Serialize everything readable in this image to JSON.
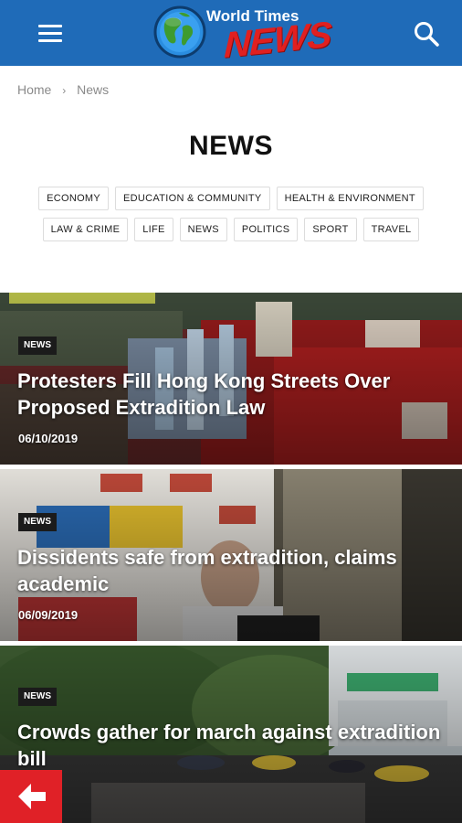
{
  "header": {
    "logo_top": "World Times",
    "logo_bottom": "NEWS",
    "menu_icon": "hamburger-menu-icon",
    "search_icon": "search-icon",
    "bar_color": "#1f6bb8"
  },
  "breadcrumb": {
    "home": "Home",
    "separator": "›",
    "current": "News"
  },
  "page_title": "NEWS",
  "categories": [
    "ECONOMY",
    "EDUCATION & COMMUNITY",
    "HEALTH & ENVIRONMENT",
    "LAW & CRIME",
    "LIFE",
    "NEWS",
    "POLITICS",
    "SPORT",
    "TRAVEL"
  ],
  "articles": [
    {
      "tag": "NEWS",
      "title": "Protesters Fill Hong Kong Streets Over Proposed Extradition Law",
      "date": "06/10/2019"
    },
    {
      "tag": "NEWS",
      "title": "Dissidents safe from extradition, claims academic",
      "date": "06/09/2019"
    },
    {
      "tag": "NEWS",
      "title": "Crowds gather for march against extradition bill",
      "date": "019"
    }
  ],
  "back_button": {
    "icon": "arrow-left-icon",
    "color": "#e02127"
  }
}
